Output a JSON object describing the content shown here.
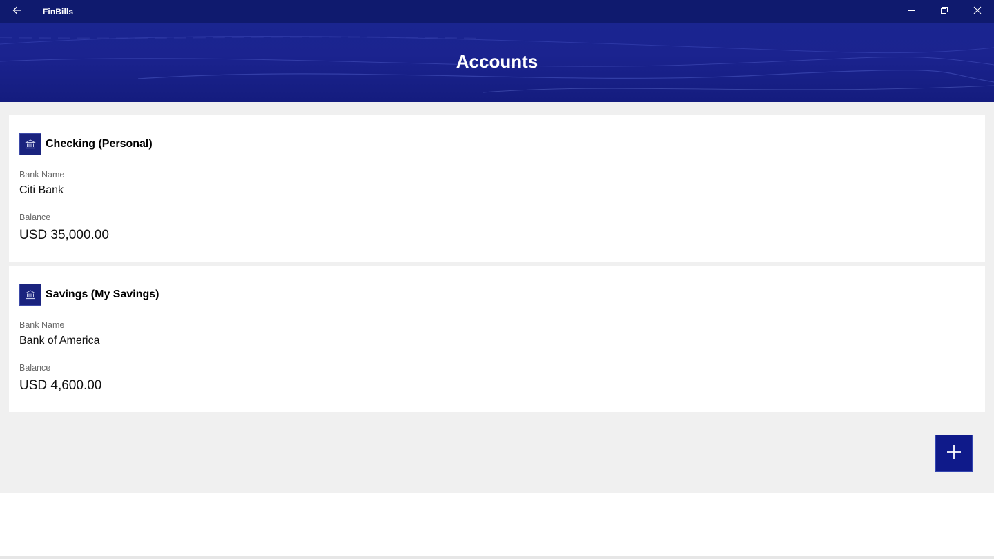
{
  "window": {
    "app_title": "FinBills",
    "back_icon": "arrow-left-icon",
    "minimize_icon": "minimize-icon",
    "restore_icon": "restore-icon",
    "close_icon": "close-icon"
  },
  "header": {
    "title": "Accounts"
  },
  "accounts": [
    {
      "icon": "bank-icon",
      "title": "Checking (Personal)",
      "bank_name_label": "Bank Name",
      "bank_name": "Citi Bank",
      "balance_label": "Balance",
      "balance": "USD 35,000.00"
    },
    {
      "icon": "bank-icon",
      "title": "Savings (My Savings)",
      "bank_name_label": "Bank Name",
      "bank_name": "Bank of America",
      "balance_label": "Balance",
      "balance": "USD 4,600.00"
    }
  ],
  "actions": {
    "add_icon": "plus-icon"
  },
  "colors": {
    "titlebar": "#0f1a6e",
    "banner": "#1a2590",
    "accent": "#0f1a8a",
    "content_bg": "#f0f0f0"
  }
}
